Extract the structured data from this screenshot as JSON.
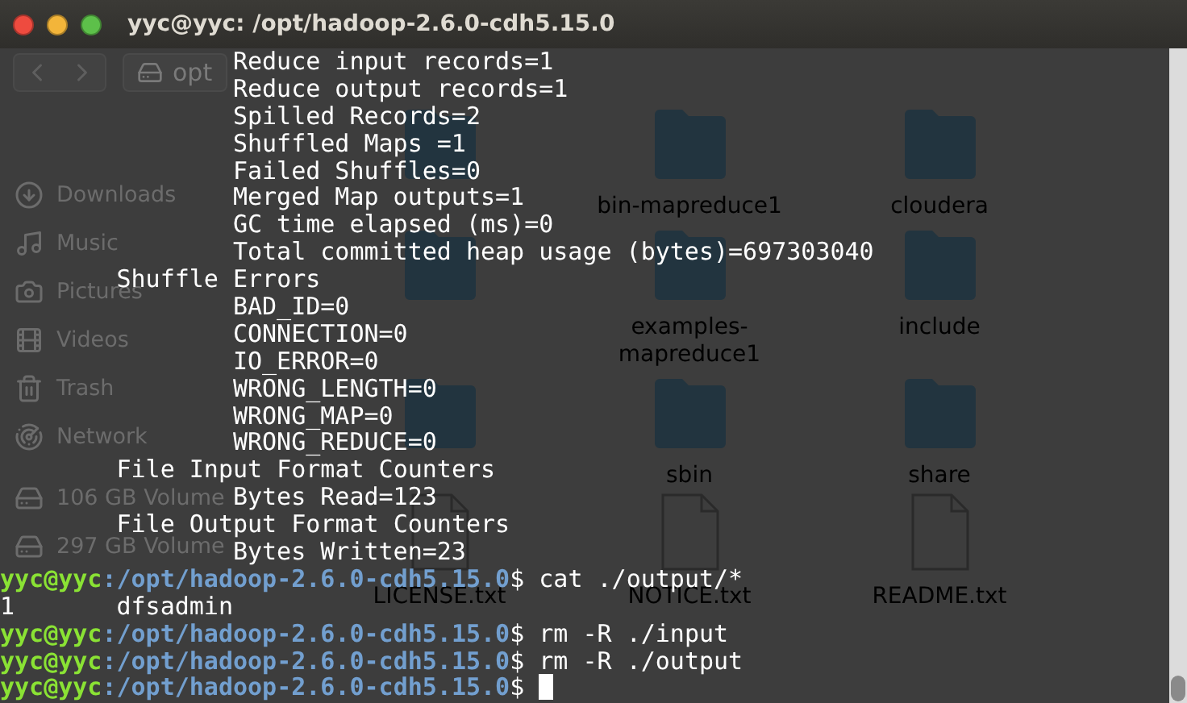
{
  "window": {
    "title": "yyc@yyc: /opt/hadoop-2.6.0-cdh5.15.0"
  },
  "file_manager": {
    "path": [
      "opt"
    ],
    "sidebar": [
      {
        "label": "Downloads",
        "kind": "download"
      },
      {
        "label": "Music",
        "kind": "music"
      },
      {
        "label": "Pictures",
        "kind": "camera"
      },
      {
        "label": "Videos",
        "kind": "film"
      },
      {
        "label": "Trash",
        "kind": "trash"
      },
      {
        "label": "Network",
        "kind": "network"
      },
      {
        "label": "106 GB Volume",
        "kind": "drive"
      },
      {
        "label": "297 GB Volume",
        "kind": "drive"
      }
    ],
    "items": [
      {
        "kind": "folder"
      },
      {
        "kind": "folder",
        "label": "bin-mapreduce1"
      },
      {
        "kind": "folder",
        "label": "cloudera"
      },
      {
        "kind": "folder"
      },
      {
        "kind": "folder",
        "label": "examples-mapreduce1"
      },
      {
        "kind": "folder",
        "label": "include"
      },
      {
        "kind": "folder"
      },
      {
        "kind": "folder",
        "label": "sbin"
      },
      {
        "kind": "folder",
        "label": "share"
      },
      {
        "kind": "file",
        "label": "LICENSE.txt"
      },
      {
        "kind": "file",
        "label": "NOTICE.txt"
      },
      {
        "kind": "file",
        "label": "README.txt"
      }
    ]
  },
  "terminal": [
    {
      "kind": "counter",
      "text": "Reduce input records=1"
    },
    {
      "kind": "counter",
      "text": "Reduce output records=1"
    },
    {
      "kind": "counter",
      "text": "Spilled Records=2"
    },
    {
      "kind": "counter",
      "text": "Shuffled Maps =1"
    },
    {
      "kind": "counter",
      "text": "Failed Shuffles=0"
    },
    {
      "kind": "counter",
      "text": "Merged Map outputs=1"
    },
    {
      "kind": "counter",
      "text": "GC time elapsed (ms)=0"
    },
    {
      "kind": "counter",
      "text": "Total committed heap usage (bytes)=697303040"
    },
    {
      "kind": "group",
      "text": "Shuffle Errors"
    },
    {
      "kind": "counter",
      "text": "BAD_ID=0"
    },
    {
      "kind": "counter",
      "text": "CONNECTION=0"
    },
    {
      "kind": "counter",
      "text": "IO_ERROR=0"
    },
    {
      "kind": "counter",
      "text": "WRONG_LENGTH=0"
    },
    {
      "kind": "counter",
      "text": "WRONG_MAP=0"
    },
    {
      "kind": "counter",
      "text": "WRONG_REDUCE=0"
    },
    {
      "kind": "group",
      "text": "File Input Format Counters"
    },
    {
      "kind": "counter",
      "text": "Bytes Read=123"
    },
    {
      "kind": "group",
      "text": "File Output Format Counters"
    },
    {
      "kind": "counter",
      "text": "Bytes Written=23"
    },
    {
      "kind": "prompt",
      "user": "yyc@yyc",
      "path": ":/opt/hadoop-2.6.0-cdh5.15.0",
      "command": "$ cat ./output/*",
      "cursor": false
    },
    {
      "kind": "output",
      "text": "1       dfsadmin"
    },
    {
      "kind": "prompt",
      "user": "yyc@yyc",
      "path": ":/opt/hadoop-2.6.0-cdh5.15.0",
      "command": "$ rm -R ./input",
      "cursor": false
    },
    {
      "kind": "prompt",
      "user": "yyc@yyc",
      "path": ":/opt/hadoop-2.6.0-cdh5.15.0",
      "command": "$ rm -R ./output",
      "cursor": false
    },
    {
      "kind": "prompt",
      "user": "yyc@yyc",
      "path": ":/opt/hadoop-2.6.0-cdh5.15.0",
      "command": "$ ",
      "cursor": true
    }
  ]
}
